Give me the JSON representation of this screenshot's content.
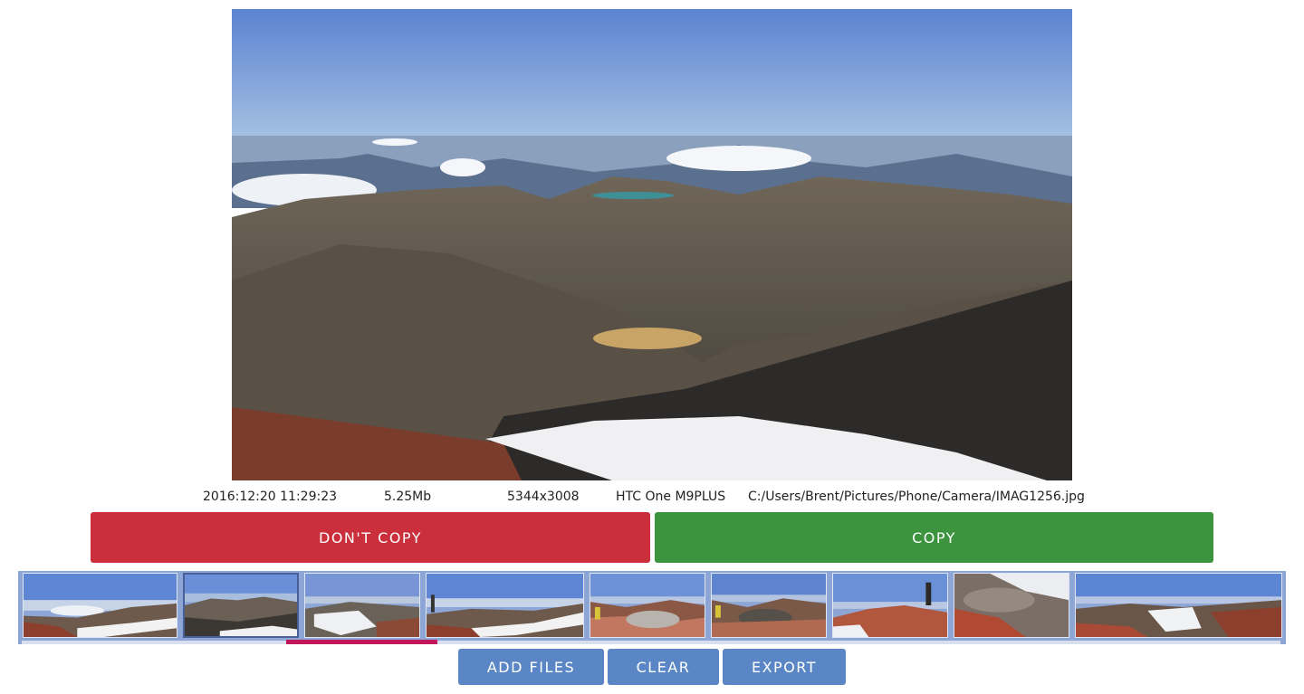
{
  "photo": {
    "date": "2016:12:20 11:29:23",
    "size": "5.25Mb",
    "dimensions": "5344x3008",
    "camera": "HTC One M9PLUS",
    "path": "C:/Users/Brent/Pictures/Phone/Camera/IMAG1256.jpg"
  },
  "actions": {
    "dont_copy_label": "DON'T COPY",
    "copy_label": "COPY",
    "add_files_label": "ADD FILES",
    "clear_label": "CLEAR",
    "export_label": "EXPORT"
  },
  "filmstrip": {
    "thumbnails": [
      {
        "id": "thumb-1",
        "selected": false
      },
      {
        "id": "thumb-2",
        "selected": true
      },
      {
        "id": "thumb-3",
        "selected": false
      },
      {
        "id": "thumb-4",
        "selected": false
      },
      {
        "id": "thumb-5",
        "selected": false
      },
      {
        "id": "thumb-6",
        "selected": false
      },
      {
        "id": "thumb-7",
        "selected": false
      },
      {
        "id": "thumb-8",
        "selected": false
      },
      {
        "id": "thumb-9",
        "selected": false
      }
    ]
  },
  "colors": {
    "dont_copy": "#cc2f3c",
    "copy": "#3d943f",
    "toolbar_button": "#5a86c5",
    "filmstrip_border": "#8ea6d6",
    "scroll_indicator": "#c2185b"
  }
}
